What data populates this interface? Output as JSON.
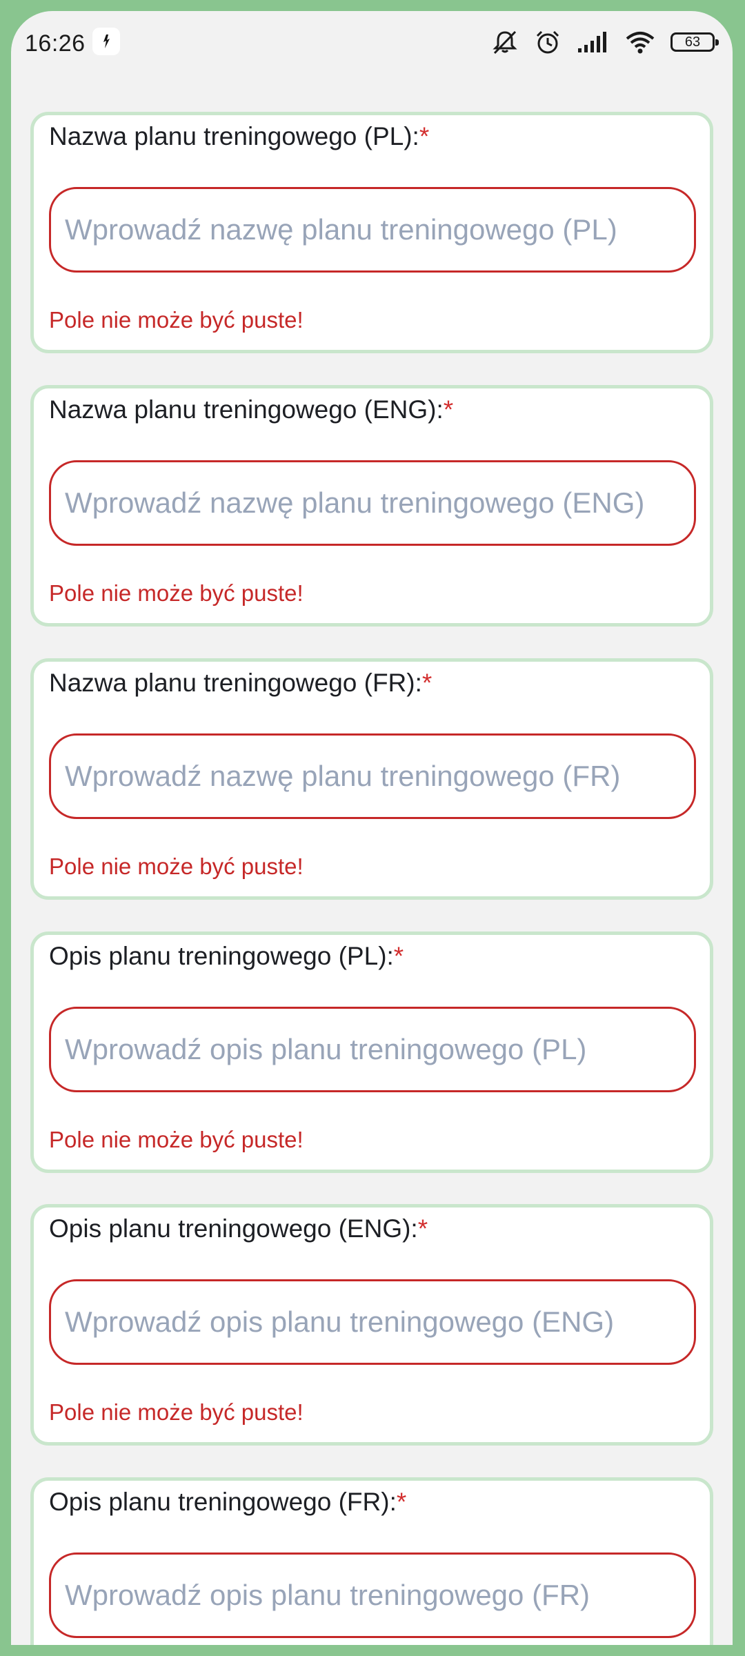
{
  "status_bar": {
    "time": "16:26",
    "battery_level": "63",
    "icons": [
      "app-notification-icon",
      "mute-icon",
      "alarm-icon",
      "signal-icon",
      "wifi-icon",
      "battery-icon"
    ]
  },
  "colors": {
    "frame_accent": "#89c58f",
    "card_border": "#c9e6cc",
    "error": "#c62828",
    "placeholder": "#98a4b8"
  },
  "form": {
    "fields": [
      {
        "label": "Nazwa planu treningowego (PL):",
        "required_mark": "*",
        "placeholder": "Wprowadź nazwę planu treningowego (PL)",
        "value": "",
        "error": "Pole nie może być puste!"
      },
      {
        "label": "Nazwa planu treningowego (ENG):",
        "required_mark": "*",
        "placeholder": "Wprowadź nazwę planu treningowego (ENG)",
        "value": "",
        "error": "Pole nie może być puste!"
      },
      {
        "label": "Nazwa planu treningowego (FR):",
        "required_mark": "*",
        "placeholder": "Wprowadź nazwę planu treningowego (FR)",
        "value": "",
        "error": "Pole nie może być puste!"
      },
      {
        "label": "Opis planu treningowego (PL):",
        "required_mark": "*",
        "placeholder": "Wprowadź opis planu treningowego (PL)",
        "value": "",
        "error": "Pole nie może być puste!"
      },
      {
        "label": "Opis planu treningowego (ENG):",
        "required_mark": "*",
        "placeholder": "Wprowadź opis planu treningowego (ENG)",
        "value": "",
        "error": "Pole nie może być puste!"
      },
      {
        "label": "Opis planu treningowego (FR):",
        "required_mark": "*",
        "placeholder": "Wprowadź opis planu treningowego (FR)",
        "value": ""
      }
    ]
  }
}
